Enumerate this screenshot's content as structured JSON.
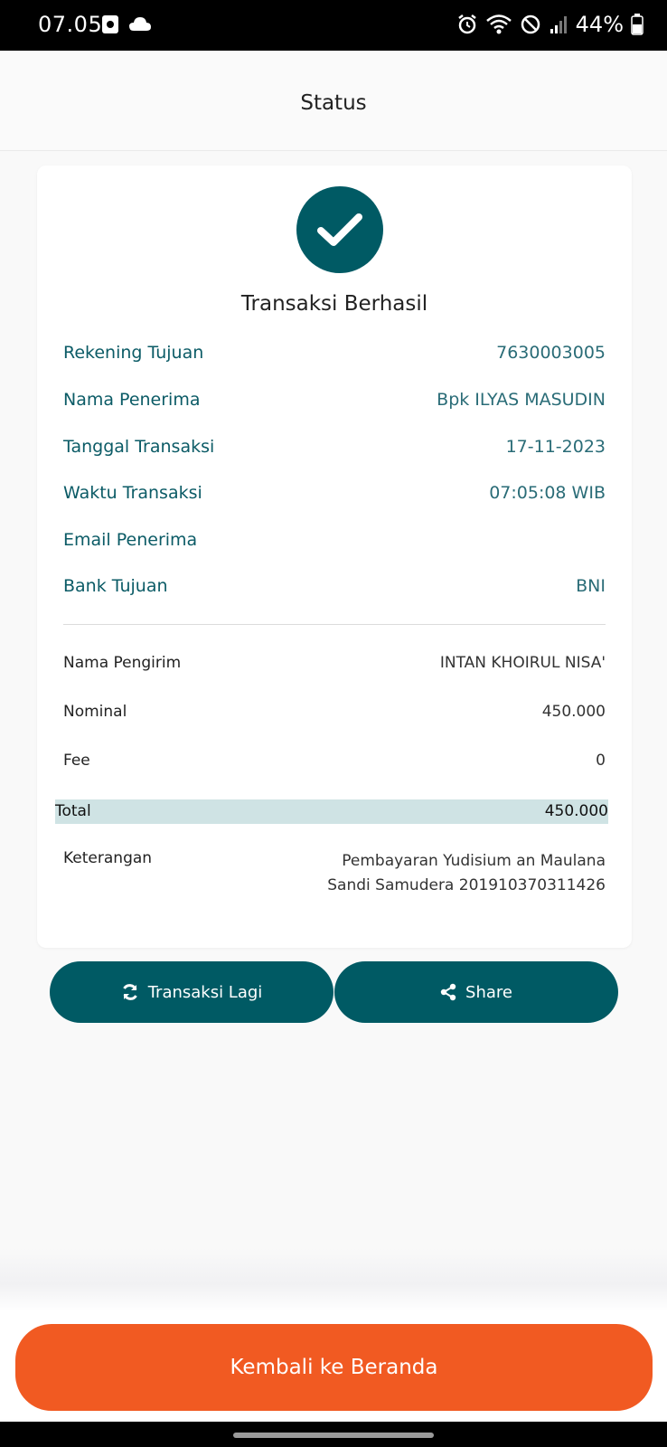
{
  "status_bar": {
    "time": "07.05",
    "battery": "44%"
  },
  "header": {
    "title": "Status"
  },
  "card": {
    "title": "Transaksi Berhasil",
    "info": [
      {
        "label": "Rekening Tujuan",
        "value": "7630003005"
      },
      {
        "label": "Nama Penerima",
        "value": "Bpk ILYAS MASUDIN"
      },
      {
        "label": "Tanggal Transaksi",
        "value": "17-11-2023"
      },
      {
        "label": "Waktu Transaksi",
        "value": "07:05:08 WIB"
      },
      {
        "label": "Email Penerima",
        "value": ""
      },
      {
        "label": "Bank Tujuan",
        "value": "BNI"
      }
    ],
    "details": [
      {
        "label": "Nama Pengirim",
        "value": "INTAN KHOIRUL NISA'"
      },
      {
        "label": "Nominal",
        "value": "450.000"
      },
      {
        "label": "Fee",
        "value": "0"
      }
    ],
    "total": {
      "label": "Total",
      "value": "450.000"
    },
    "keterangan": {
      "label": "Keterangan",
      "value": "Pembayaran Yudisium an Maulana Sandi Samudera 201910370311426"
    }
  },
  "actions": {
    "again_label": "Transaksi Lagi",
    "share_label": "Share"
  },
  "footer": {
    "home_label": "Kembali ke Beranda"
  },
  "colors": {
    "primary": "#005a64",
    "accent": "#f15a22",
    "total_bg": "#cfe3e4"
  }
}
